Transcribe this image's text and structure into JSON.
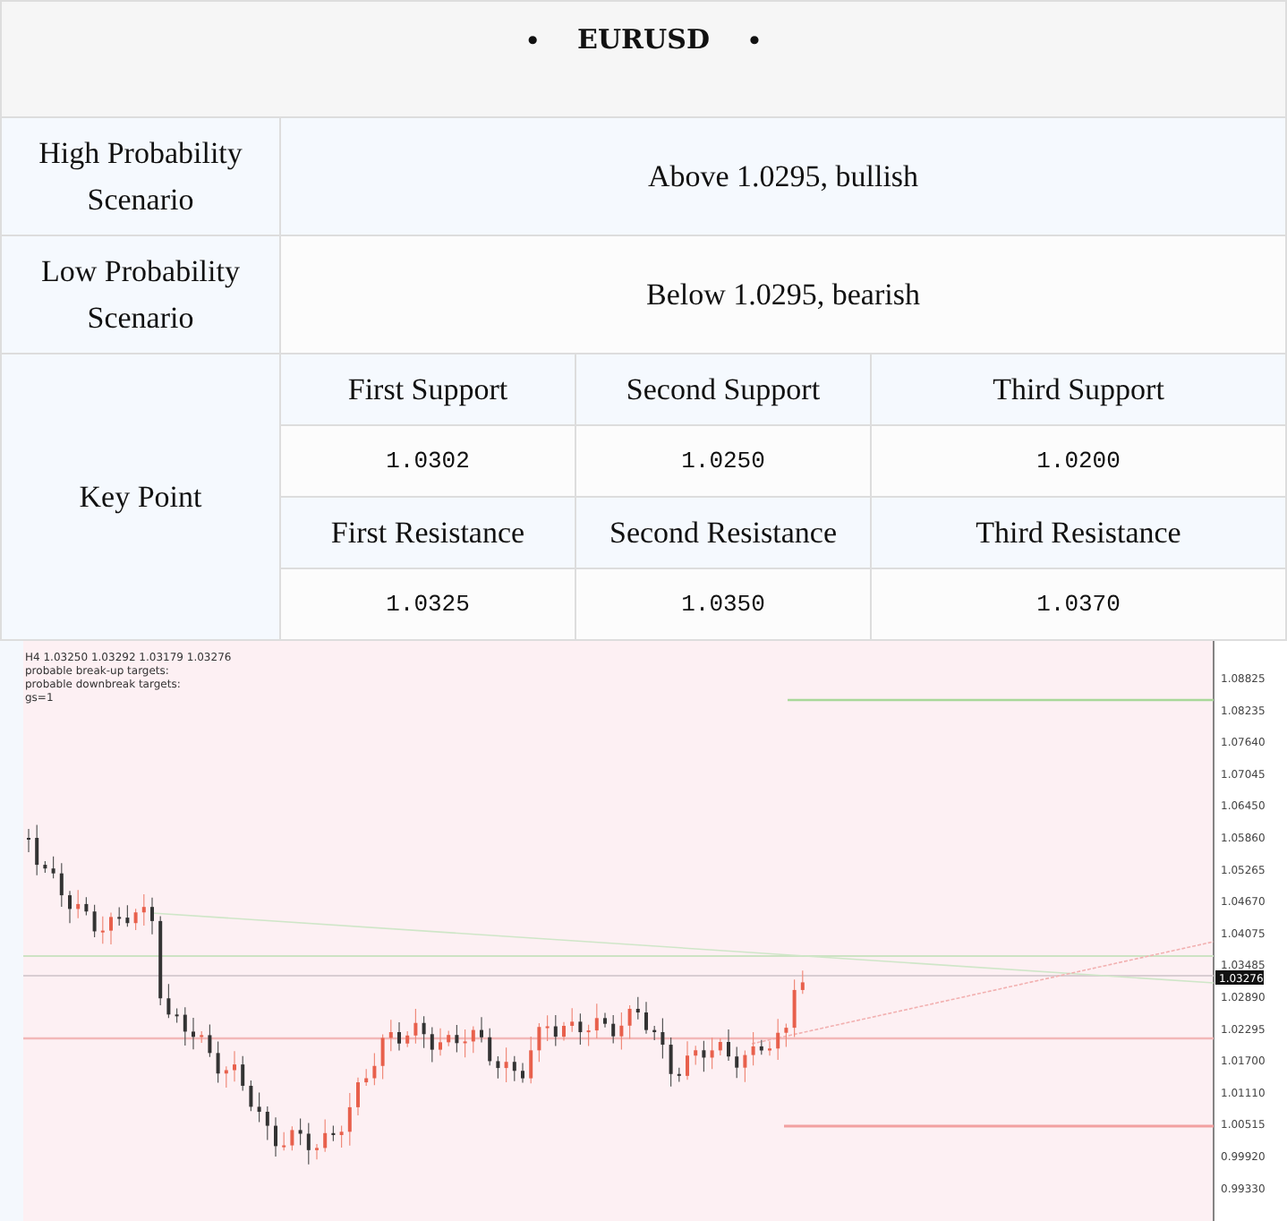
{
  "header": {
    "markers": [
      "•",
      "•"
    ],
    "title": "EURUSD"
  },
  "scenarios": [
    {
      "label": "High Probability Scenario",
      "value": "Above 1.0295, bullish"
    },
    {
      "label": "Low Probability Scenario",
      "value": "Below 1.0295, bearish"
    }
  ],
  "key_point": {
    "label": "Key Point",
    "groups": [
      {
        "headers": [
          "First Support",
          "Second Support",
          "Third Support"
        ],
        "values": [
          "1.0302",
          "1.0250",
          "1.0200"
        ]
      },
      {
        "headers": [
          "First Resistance",
          "Second Resistance",
          "Third Resistance"
        ],
        "values": [
          "1.0325",
          "1.0350",
          "1.0370"
        ]
      }
    ]
  },
  "chart": {
    "info_lines": [
      "H4 1.03250 1.03292 1.03179 1.03276",
      "probable break-up targets:",
      "probable downbreak targets:",
      "gs=1"
    ],
    "price_labels": [
      "1.08825",
      "1.08235",
      "1.07640",
      "1.07045",
      "1.06450",
      "1.05860",
      "1.05265",
      "1.04670",
      "1.04075",
      "1.03485",
      "1.02890",
      "1.02295",
      "1.01700",
      "1.01110",
      "1.00515",
      "0.99920",
      "0.99330"
    ],
    "current_price": "1.03276"
  }
}
